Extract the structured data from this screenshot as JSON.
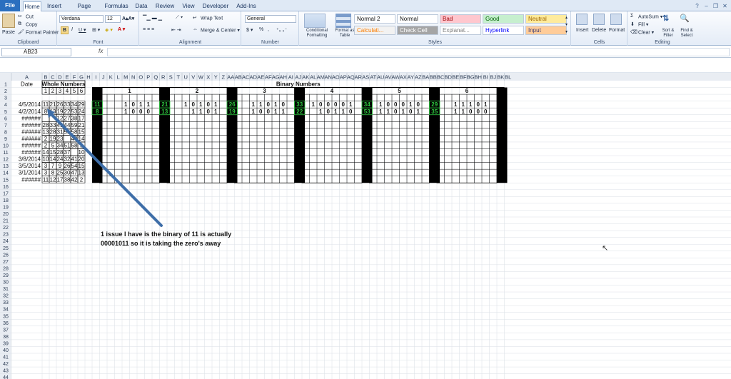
{
  "tabs": [
    {
      "label": "File",
      "active": false,
      "file": true
    },
    {
      "label": "Home",
      "active": true
    },
    {
      "label": "Insert",
      "active": false
    },
    {
      "label": "Page Layout",
      "active": false
    },
    {
      "label": "Formulas",
      "active": false
    },
    {
      "label": "Data",
      "active": false
    },
    {
      "label": "Review",
      "active": false
    },
    {
      "label": "View",
      "active": false
    },
    {
      "label": "Developer",
      "active": false
    },
    {
      "label": "Add-Ins",
      "active": false
    }
  ],
  "clipboard": {
    "paste": "Paste",
    "cut": "Cut",
    "copy": "Copy",
    "format_painter": "Format Painter",
    "label": "Clipboard"
  },
  "font": {
    "name": "Verdana",
    "size": "12",
    "label": "Font"
  },
  "alignment": {
    "wrap": "Wrap Text",
    "merge": "Merge & Center",
    "label": "Alignment"
  },
  "number": {
    "format": "General",
    "label": "Number",
    "currency": "$",
    "percent": "%",
    "comma": ","
  },
  "styles": {
    "cond_format": "Conditional Formatting",
    "format_table": "Format as Table",
    "cells": [
      {
        "text": "Normal 2",
        "bg": "#ffffff",
        "fg": "#111111"
      },
      {
        "text": "Normal",
        "bg": "#ffffff",
        "fg": "#111111"
      },
      {
        "text": "Bad",
        "bg": "#ffc7ce",
        "fg": "#9c0006"
      },
      {
        "text": "Good",
        "bg": "#c6efce",
        "fg": "#006100"
      },
      {
        "text": "Neutral",
        "bg": "#ffeb9c",
        "fg": "#9c6500"
      },
      {
        "text": "Calculati...",
        "bg": "#f2f2f2",
        "fg": "#fa7d00"
      },
      {
        "text": "Check Cell",
        "bg": "#a5a5a5",
        "fg": "#ffffff"
      },
      {
        "text": "Explanat...",
        "bg": "#ffffff",
        "fg": "#7f7f7f"
      },
      {
        "text": "Hyperlink",
        "bg": "#ffffff",
        "fg": "#0000ff"
      },
      {
        "text": "Input",
        "bg": "#ffcc99",
        "fg": "#3f3f76"
      }
    ],
    "label": "Styles"
  },
  "cells_group": {
    "insert": "Insert",
    "delete": "Delete",
    "format": "Format",
    "label": "Cells"
  },
  "editing": {
    "autosum": "AutoSum",
    "fill": "Fill",
    "clear": "Clear",
    "sort": "Sort & Filter",
    "find": "Find & Select",
    "label": "Editing"
  },
  "namebox": "AB23",
  "fx": "fx",
  "columns": [
    "A",
    "B",
    "C",
    "D",
    "E",
    "F",
    "G",
    "H",
    "I",
    "J",
    "K",
    "L",
    "M",
    "N",
    "O",
    "P",
    "Q",
    "R",
    "S",
    "T",
    "U",
    "V",
    "W",
    "X",
    "Y",
    "Z",
    "AA",
    "AB",
    "AC",
    "AD",
    "AE",
    "AF",
    "AG",
    "AH",
    "AI",
    "AJ",
    "AK",
    "AL",
    "AM",
    "AN",
    "AO",
    "AP",
    "AQ",
    "AR",
    "AS",
    "AT",
    "AU",
    "AV",
    "AW",
    "AX",
    "AY",
    "AZ",
    "BA",
    "BB",
    "BC",
    "BD",
    "BE",
    "BF",
    "BG",
    "BH",
    "BI",
    "BJ",
    "BK",
    "BL"
  ],
  "sheet": {
    "row1": {
      "date_header": "Date",
      "whole_header": "Whole Numbers",
      "binary_header": "Binary Numbers"
    },
    "whole_idx": [
      "1",
      "2",
      "3",
      "4",
      "5",
      "6"
    ],
    "binary_group_labels": [
      "1",
      "2",
      "3",
      "4",
      "5",
      "6"
    ],
    "data_rows": [
      {
        "date": "4/5/2014",
        "vals": [
          "11",
          "21",
          "26",
          "33",
          "34",
          "29"
        ]
      },
      {
        "date": "4/2/2014",
        "vals": [
          "8",
          "13",
          "19",
          "22",
          "53",
          "24"
        ]
      },
      {
        "date": "######",
        "vals": [
          "",
          "",
          "12",
          "27",
          "38",
          "17"
        ]
      },
      {
        "date": "######",
        "vals": [
          "28",
          "33",
          "41",
          "44",
          "59",
          "21"
        ]
      },
      {
        "date": "######",
        "vals": [
          "13",
          "28",
          "31",
          "55",
          "58",
          "15"
        ]
      },
      {
        "date": "######",
        "vals": [
          "2",
          "19",
          "23",
          "",
          "43",
          "14"
        ]
      },
      {
        "date": "######",
        "vals": [
          "2",
          "5",
          "34",
          "51",
          "58",
          "9"
        ]
      },
      {
        "date": "######",
        "vals": [
          "14",
          "15",
          "28",
          "37",
          "",
          "10"
        ]
      },
      {
        "date": "3/8/2014",
        "vals": [
          "10",
          "14",
          "24",
          "32",
          "41",
          "20"
        ]
      },
      {
        "date": "3/5/2014",
        "vals": [
          "3",
          "7",
          "9",
          "26",
          "54",
          "15"
        ]
      },
      {
        "date": "3/1/2014",
        "vals": [
          "3",
          "8",
          "25",
          "30",
          "47",
          "13"
        ]
      },
      {
        "date": "######",
        "vals": [
          "11",
          "12",
          "17",
          "38",
          "42",
          "2"
        ]
      }
    ],
    "binary_rows": {
      "row4": {
        "groups": [
          {
            "marker": "11",
            "bits": [
              "1",
              "0",
              "1",
              "1"
            ]
          },
          {
            "marker": "21",
            "bits": [
              "1",
              "0",
              "1",
              "0",
              "1"
            ]
          },
          {
            "marker": "26",
            "bits": [
              "1",
              "1",
              "0",
              "1",
              "0"
            ]
          },
          {
            "marker": "33",
            "bits": [
              "1",
              "0",
              "0",
              "0",
              "0",
              "1"
            ]
          },
          {
            "marker": "34",
            "bits": [
              "1",
              "0",
              "0",
              "0",
              "1",
              "0"
            ]
          },
          {
            "marker": "29",
            "bits": [
              "1",
              "1",
              "1",
              "0",
              "1"
            ]
          }
        ]
      },
      "row5": {
        "groups": [
          {
            "marker": "8",
            "bits": [
              "1",
              "0",
              "0",
              "0"
            ]
          },
          {
            "marker": "13",
            "bits": [
              "1",
              "1",
              "0",
              "1"
            ]
          },
          {
            "marker": "19",
            "bits": [
              "1",
              "0",
              "0",
              "1",
              "1"
            ]
          },
          {
            "marker": "22",
            "bits": [
              "1",
              "0",
              "1",
              "1",
              "0"
            ]
          },
          {
            "marker": "53",
            "bits": [
              "1",
              "1",
              "0",
              "1",
              "0",
              "1"
            ]
          },
          {
            "marker": "35",
            "bits": [
              "1",
              "1",
              "0",
              "0",
              "0"
            ]
          }
        ]
      }
    },
    "row_count": 52
  },
  "callout_text": "1 issue  I have is the binary of 11 is actually 00001011  so it is taking the zero's away",
  "colors": {
    "marker_fg": "#2ecc40",
    "black_bar": "#000000",
    "arrow": "#3e6ea8",
    "header_bg": "#e9edf3",
    "grid": "#dadfe6"
  }
}
